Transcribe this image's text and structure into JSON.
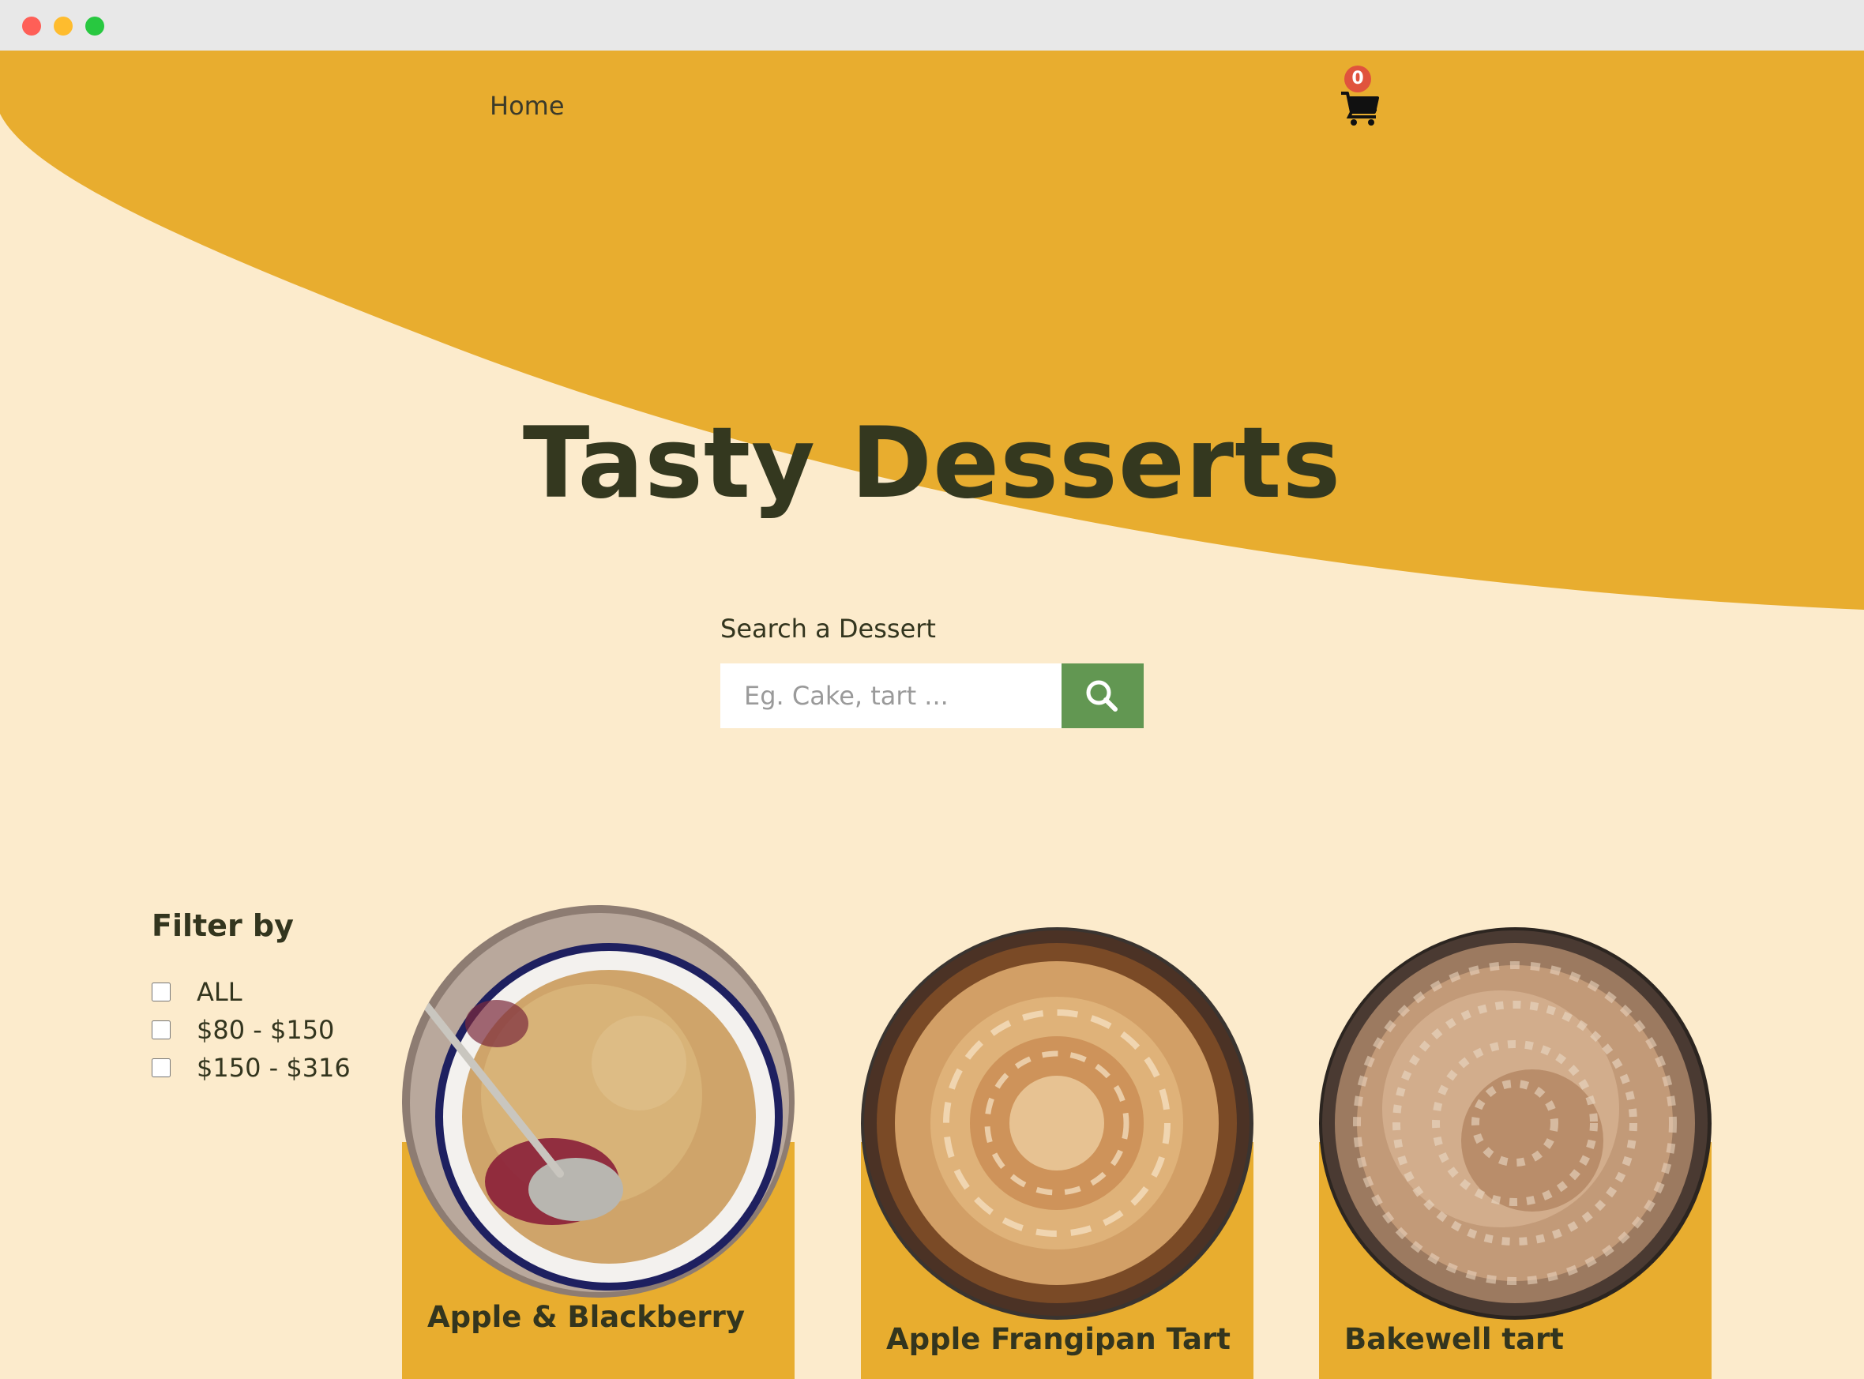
{
  "nav": {
    "home_label": "Home",
    "cart_count": "0",
    "cart_icon": "cart-icon"
  },
  "hero": {
    "title": "Tasty Desserts"
  },
  "search": {
    "label": "Search a Dessert",
    "placeholder": "Eg. Cake, tart ...",
    "value": "",
    "button_icon": "search-icon"
  },
  "filter": {
    "title": "Filter by",
    "options": [
      "ALL",
      "$80 - $150",
      "$150 - $316"
    ]
  },
  "products": [
    {
      "name": "Apple & Blackberry"
    },
    {
      "name": "Apple Frangipan Tart"
    },
    {
      "name": "Bakewell tart"
    }
  ],
  "colors": {
    "accent": "#e8ad2f",
    "background": "#fcebcc",
    "text": "#33351e",
    "search_button": "#629752",
    "badge": "#e0533d"
  }
}
